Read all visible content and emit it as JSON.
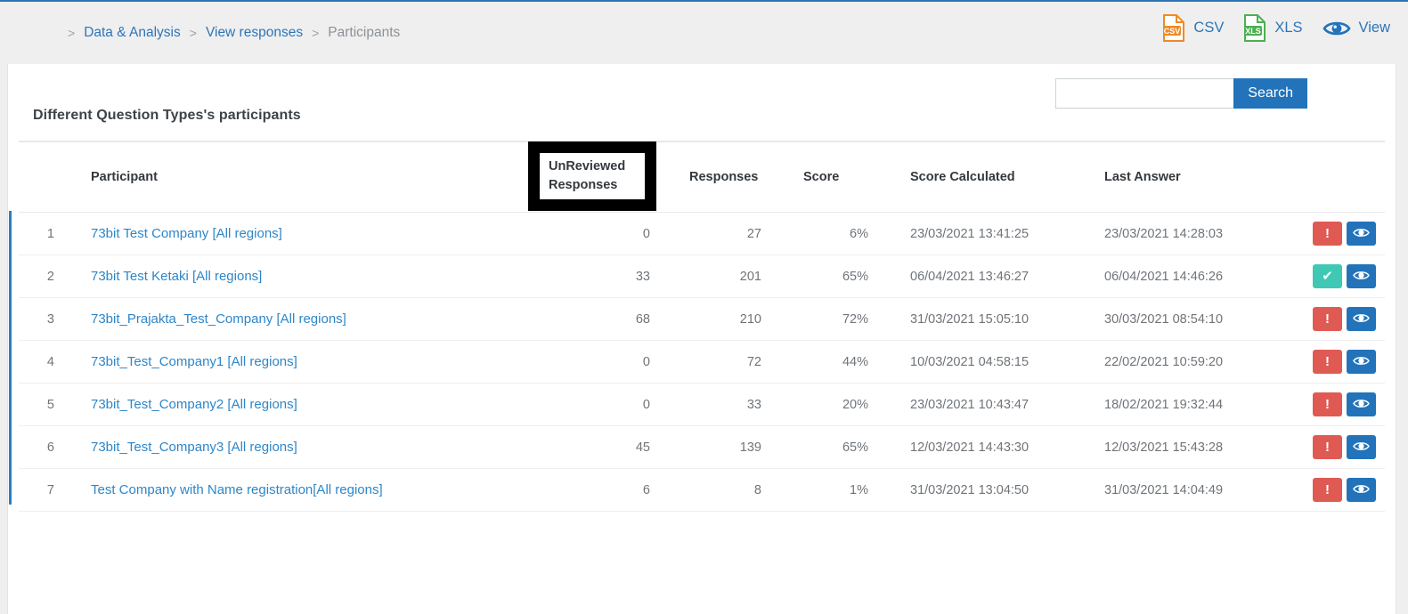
{
  "breadcrumb": {
    "separator": ">",
    "items": [
      {
        "label": "Data & Analysis",
        "current": false
      },
      {
        "label": "View responses",
        "current": false
      },
      {
        "label": "Participants",
        "current": true
      }
    ]
  },
  "export": {
    "csv_label": "CSV",
    "csv_icon": "csv-file-icon",
    "csv_badge": "CSV",
    "xls_label": "XLS",
    "xls_icon": "xls-file-icon",
    "xls_badge": "XLS",
    "view_label": "View",
    "view_icon": "eye-icon"
  },
  "card": {
    "title": "Different Question Types's participants"
  },
  "search": {
    "value": "",
    "placeholder": "",
    "button_label": "Search"
  },
  "table": {
    "headers": {
      "index": "",
      "participant": "Participant",
      "unreviewed": "UnReviewed Responses",
      "unreviewed_line1": "UnReviewed",
      "unreviewed_line2": "Responses",
      "responses": "Responses",
      "score": "Score",
      "score_calculated": "Score Calculated",
      "last_answer": "Last Answer",
      "actions": ""
    },
    "highlight": {
      "column": "unreviewed",
      "color": "#000000"
    },
    "rows": [
      {
        "index": "1",
        "participant": "73bit Test Company [All regions]",
        "unreviewed": "0",
        "responses": "27",
        "score": "6%",
        "score_calculated": "23/03/2021 13:41:25",
        "last_answer": "23/03/2021 14:28:03",
        "status": "alert",
        "status_glyph": "!",
        "view_glyph": "eye-icon"
      },
      {
        "index": "2",
        "participant": "73bit Test Ketaki [All regions]",
        "unreviewed": "33",
        "responses": "201",
        "score": "65%",
        "score_calculated": "06/04/2021 13:46:27",
        "last_answer": "06/04/2021 14:46:26",
        "status": "ok",
        "status_glyph": "✔",
        "view_glyph": "eye-icon"
      },
      {
        "index": "3",
        "participant": "73bit_Prajakta_Test_Company [All regions]",
        "unreviewed": "68",
        "responses": "210",
        "score": "72%",
        "score_calculated": "31/03/2021 15:05:10",
        "last_answer": "30/03/2021 08:54:10",
        "status": "alert",
        "status_glyph": "!",
        "view_glyph": "eye-icon"
      },
      {
        "index": "4",
        "participant": "73bit_Test_Company1 [All regions]",
        "unreviewed": "0",
        "responses": "72",
        "score": "44%",
        "score_calculated": "10/03/2021 04:58:15",
        "last_answer": "22/02/2021 10:59:20",
        "status": "alert",
        "status_glyph": "!",
        "view_glyph": "eye-icon"
      },
      {
        "index": "5",
        "participant": "73bit_Test_Company2 [All regions]",
        "unreviewed": "0",
        "responses": "33",
        "score": "20%",
        "score_calculated": "23/03/2021 10:43:47",
        "last_answer": "18/02/2021 19:32:44",
        "status": "alert",
        "status_glyph": "!",
        "view_glyph": "eye-icon"
      },
      {
        "index": "6",
        "participant": "73bit_Test_Company3 [All regions]",
        "unreviewed": "45",
        "responses": "139",
        "score": "65%",
        "score_calculated": "12/03/2021 14:43:30",
        "last_answer": "12/03/2021 15:43:28",
        "status": "alert",
        "status_glyph": "!",
        "view_glyph": "eye-icon"
      },
      {
        "index": "7",
        "participant": "Test Company with Name registration[All regions]",
        "unreviewed": "6",
        "responses": "8",
        "score": "1%",
        "score_calculated": "31/03/2021 13:04:50",
        "last_answer": "31/03/2021 14:04:49",
        "status": "alert",
        "status_glyph": "!",
        "view_glyph": "eye-icon"
      }
    ]
  },
  "colors": {
    "accent_blue": "#2273ba",
    "link_blue": "#2e86c8",
    "alert_red": "#e05a54",
    "ok_teal": "#3fc9b4",
    "csv_orange": "#f08a24",
    "xls_green": "#4cb050"
  }
}
